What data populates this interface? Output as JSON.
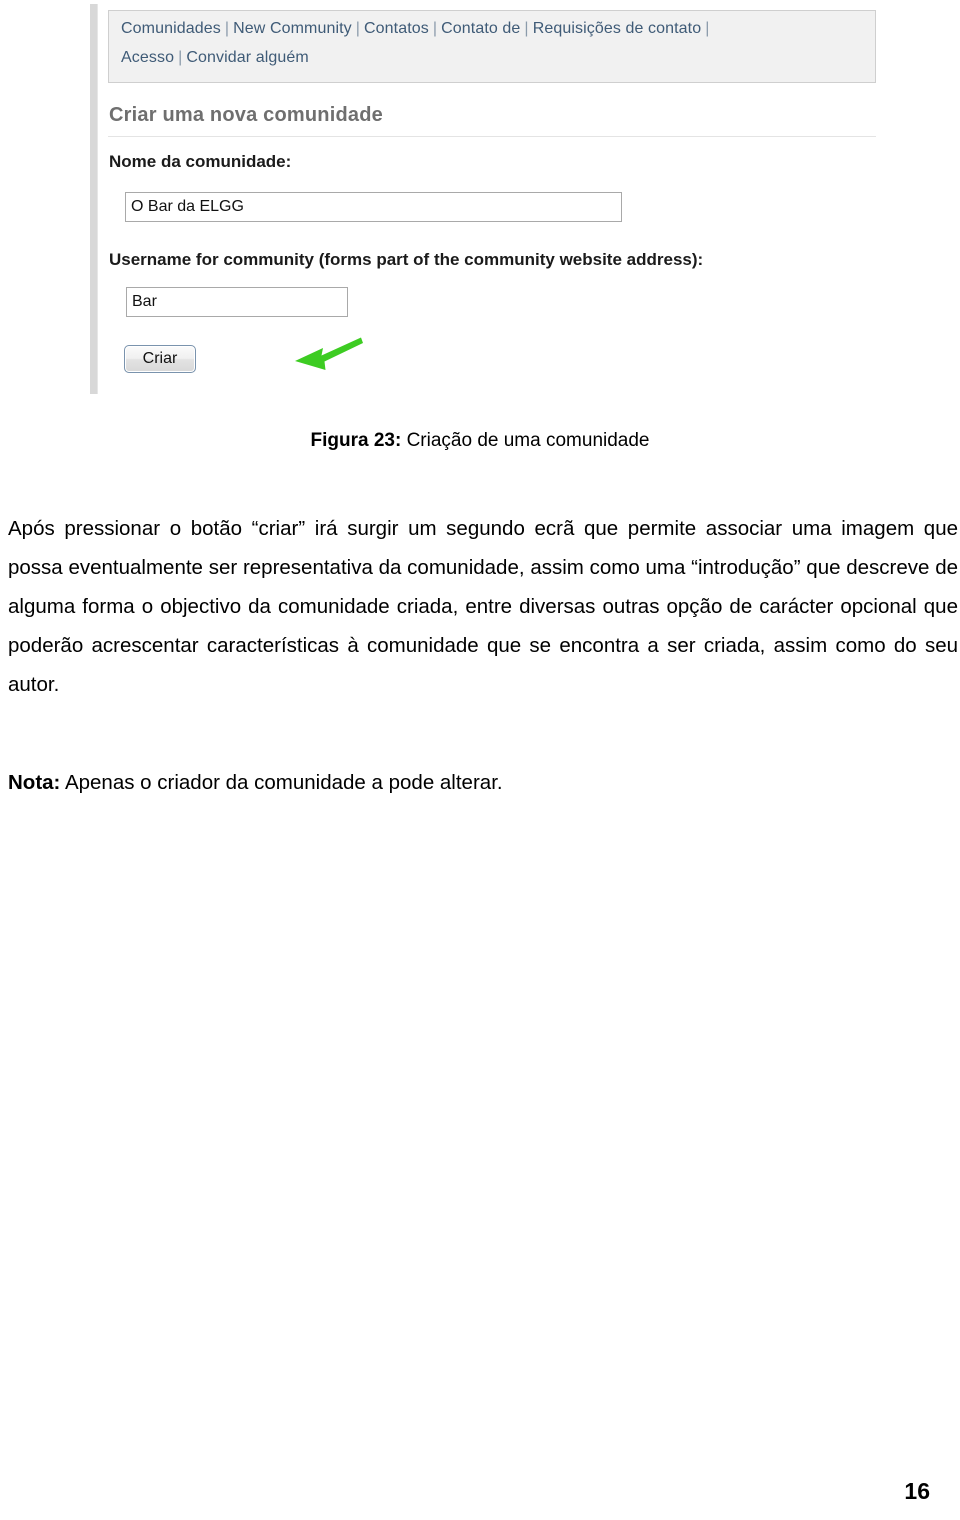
{
  "figure": {
    "screenshot": {
      "nav": {
        "row1": [
          {
            "label": "Comunidades"
          },
          {
            "label": "New Community"
          },
          {
            "label": "Contatos"
          },
          {
            "label": "Contato de"
          },
          {
            "label": "Requisições de contato"
          }
        ],
        "row2": [
          {
            "label": "Acesso"
          },
          {
            "label": "Convidar alguém"
          }
        ],
        "separator": "|",
        "link_color": "#3f5b77",
        "background": "#f1f1f1"
      },
      "heading": "Criar uma nova comunidade",
      "fields": [
        {
          "label": "Nome da comunidade:",
          "value": "O Bar da ELGG",
          "placeholder": ""
        },
        {
          "label": "Username for community (forms part of the community website address):",
          "value": "Bar",
          "placeholder": ""
        }
      ],
      "submit_button": "Criar",
      "annotation_arrow": {
        "icon": "arrow-left-icon",
        "color": "#3dcc22",
        "points_to": "Criar"
      }
    },
    "caption_prefix": "Figura 23:",
    "caption_text": " Criação de uma comunidade"
  },
  "document": {
    "paragraph_1": "Após pressionar o botão “criar” irá surgir um segundo ecrã que permite associar uma imagem que possa eventualmente ser representativa da comunidade, assim como uma “introdução” que descreve de alguma forma o objectivo da comunidade criada, entre diversas outras opção de carácter opcional que poderão acrescentar características à comunidade que se encontra a ser criada, assim como do seu autor.",
    "note_prefix": "Nota:",
    "note_text": " Apenas o criador da comunidade a pode alterar.",
    "page_number": "16"
  }
}
